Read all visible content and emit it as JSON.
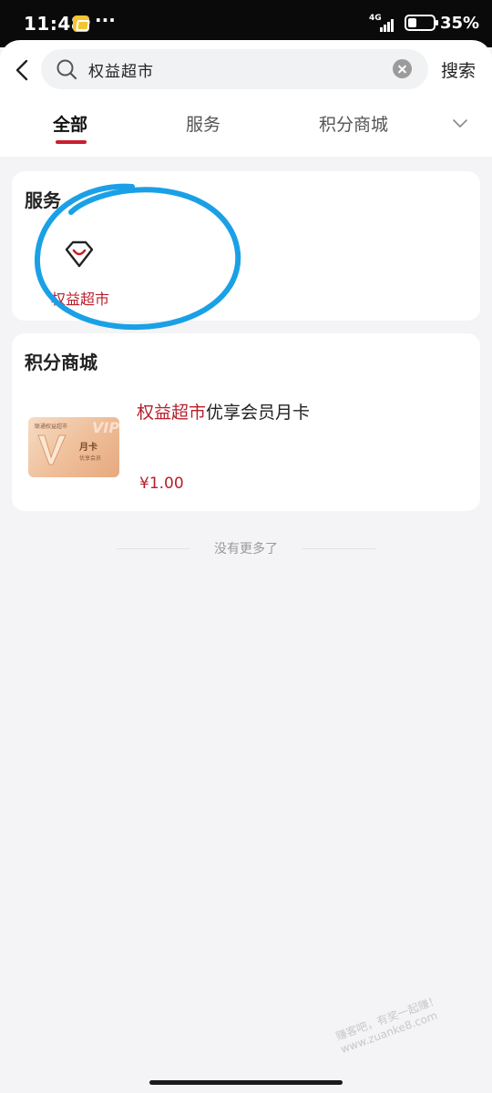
{
  "status_bar": {
    "time": "11:48",
    "more": "···",
    "network": "4G",
    "battery": "35%"
  },
  "search": {
    "query": "权益超市",
    "button_label": "搜索"
  },
  "tabs": [
    {
      "label": "全部",
      "active": true
    },
    {
      "label": "服务",
      "active": false
    },
    {
      "label": "积分商城",
      "active": false
    }
  ],
  "services": {
    "title": "服务",
    "items": [
      {
        "label": "权益超市",
        "icon": "shopping-bag-icon"
      }
    ]
  },
  "points_mall": {
    "title": "积分商城",
    "products": [
      {
        "title_highlight": "权益超市",
        "title_rest": "优享会员月卡",
        "price": "¥1.00",
        "thumb_top": "联通权益超市",
        "thumb_main": "月卡",
        "thumb_sub": "优享会员",
        "thumb_vip": "VIP"
      }
    ]
  },
  "footer": {
    "no_more": "没有更多了"
  },
  "watermark": "赚客吧，有奖一起赚！ www.zuanke8.com",
  "colors": {
    "accent": "#c81f2d",
    "annotation": "#1aa0e6",
    "background": "#f4f4f6"
  }
}
